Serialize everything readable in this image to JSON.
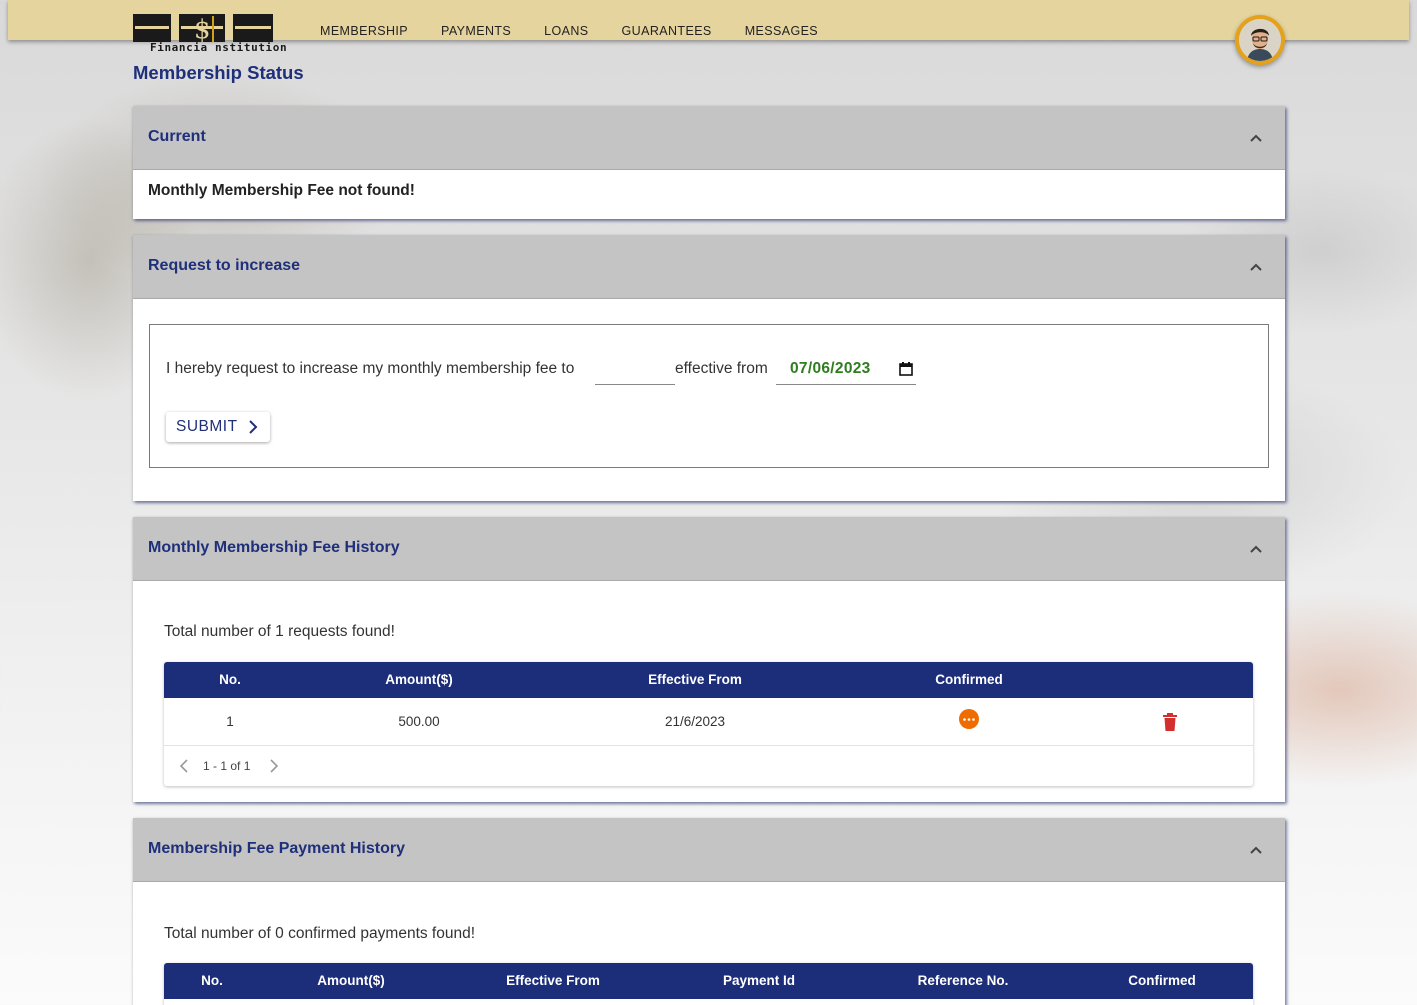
{
  "brand": {
    "logo_text": "Financia  nstitution"
  },
  "nav": {
    "items": [
      "MEMBERSHIP",
      "PAYMENTS",
      "LOANS",
      "GUARANTEES",
      "MESSAGES"
    ]
  },
  "page": {
    "title": "Membership Status"
  },
  "colors": {
    "topbar": "#e6d49e",
    "accent": "#1f2f7a",
    "table_header": "#1c2d79",
    "pending": "#ef6c00",
    "delete": "#d32f2f",
    "date_value": "#2e7d1f"
  },
  "panels": {
    "current": {
      "title": "Current",
      "message": "Monthly Membership Fee not found!"
    },
    "request": {
      "title": "Request to increase",
      "text_before": "I hereby request to increase my monthly membership fee to",
      "amount_value": "",
      "text_after": "effective from",
      "date_value": "07/06/2023",
      "submit_label": "SUBMIT"
    },
    "fee_history": {
      "title": "Monthly Membership Fee History",
      "total_text": "Total number of 1 requests found!",
      "columns": [
        "No.",
        "Amount($)",
        "Effective From",
        "Confirmed"
      ],
      "rows": [
        {
          "no": "1",
          "amount": "500.00",
          "effective_from": "21/6/2023",
          "confirmed_icon": "pending-dots-icon",
          "action_icon": "trash-icon"
        }
      ],
      "pagination": "1 - 1 of 1"
    },
    "payment_history": {
      "title": "Membership Fee Payment History",
      "total_text": "Total number of 0 confirmed payments found!",
      "columns": [
        "No.",
        "Amount($)",
        "Effective From",
        "Payment Id",
        "Reference No.",
        "Confirmed"
      ]
    }
  }
}
